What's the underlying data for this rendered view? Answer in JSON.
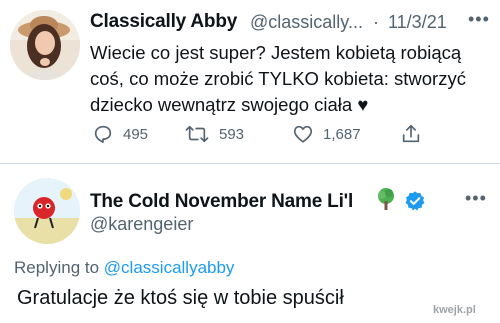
{
  "tweet": {
    "author_name": "Classically Abby",
    "author_handle": "@classically...",
    "separator": "·",
    "date": "11/3/21",
    "more_icon": "more-icon",
    "text": "Wiecie co jest super? Jestem kobietą robiącą coś, co może zrobić TYLKO kobieta: stworzyć dziecko wewnątrz swojego ciała ♥",
    "actions": {
      "reply_count": "495",
      "retweet_count": "593",
      "like_count": "1,687"
    }
  },
  "reply": {
    "author_name": "The Cold November Name Li'l",
    "author_handle": "@karengeier",
    "replying_prefix": "Replying to",
    "replying_mention": "@classicallyabby",
    "text": "Gratulacje że ktoś się w tobie spuścił"
  },
  "watermark": "kwejk.pl",
  "colors": {
    "accent": "#1d9bf0",
    "muted": "#536471",
    "text": "#0f1419",
    "divider": "#cfd9de"
  }
}
